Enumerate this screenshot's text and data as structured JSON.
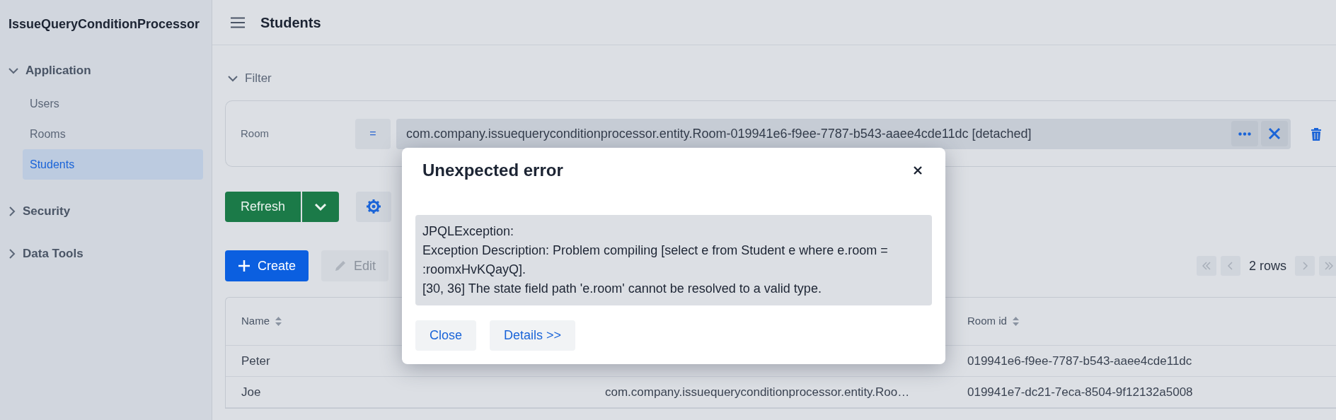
{
  "app": {
    "title": "IssueQueryConditionProcessor"
  },
  "header": {
    "title": "Students"
  },
  "sidebar": {
    "groups": [
      {
        "label": "Application",
        "expanded": true,
        "items": [
          {
            "label": "Users",
            "selected": false
          },
          {
            "label": "Rooms",
            "selected": false
          },
          {
            "label": "Students",
            "selected": true
          }
        ]
      },
      {
        "label": "Security",
        "expanded": false
      },
      {
        "label": "Data Tools",
        "expanded": false
      }
    ]
  },
  "filter": {
    "label": "Filter",
    "expanded": true,
    "conditions": [
      {
        "property": "Room",
        "operator": "=",
        "value": "com.company.issuequeryconditionprocessor.entity.Room-019941e6-f9ee-7787-b543-aaee4cde11dc [detached]"
      }
    ]
  },
  "toolbar": {
    "refresh": "Refresh",
    "create": {
      "label": "Create",
      "disabled": false
    },
    "edit": {
      "label": "Edit",
      "disabled": true
    }
  },
  "pagination": {
    "text": "2 rows"
  },
  "table": {
    "columns": [
      {
        "label": "Name"
      },
      null,
      {
        "label": "Room id"
      }
    ],
    "rows": [
      {
        "cells": [
          "Peter",
          null,
          "019941e6-f9ee-7787-b543-aaee4cde11dc"
        ]
      },
      {
        "cells": [
          "Joe",
          "com.company.issuequeryconditionprocessor.entity.Roo…",
          "019941e7-dc21-7eca-8504-9f12132a5008"
        ]
      }
    ]
  },
  "dialog": {
    "title": "Unexpected error",
    "message": [
      "JPQLException:",
      "Exception Description: Problem compiling [select e from Student e where e.room = :roomxHvKQayQ].",
      "[30, 36] The state field path 'e.room' cannot be resolved to a valid type."
    ],
    "buttons": [
      "Close",
      "Details >>"
    ]
  }
}
